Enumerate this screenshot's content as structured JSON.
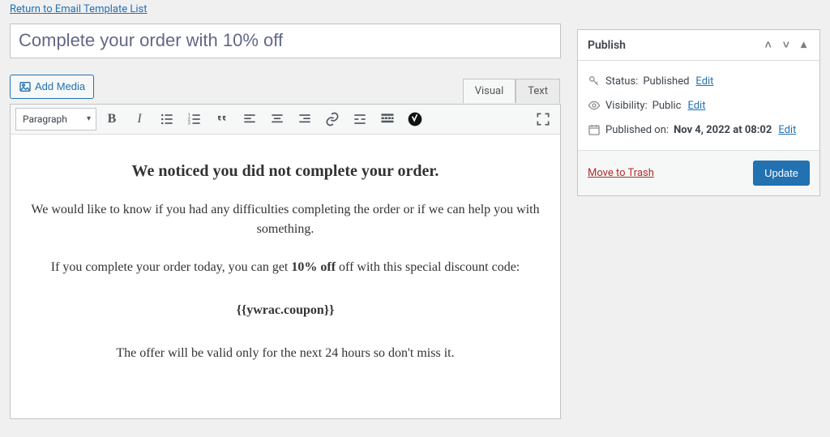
{
  "header": {
    "return_link": "Return to Email Template List",
    "title": "Complete your order with 10% off"
  },
  "editor": {
    "add_media": "Add Media",
    "tabs": {
      "visual": "Visual",
      "text": "Text"
    },
    "format_dropdown": "Paragraph",
    "content": {
      "heading": "We noticed you did not complete your order.",
      "p1": "We would like to know if you had any difficulties completing the order or if we can help you with something.",
      "p2_pre": "If you complete your order today, you can get ",
      "p2_bold": "10% off",
      "p2_post": " off with this special discount code:",
      "coupon": "{{ywrac.coupon}}",
      "p3": "The offer will be valid only for the next 24 hours so don't miss it."
    }
  },
  "publish": {
    "title": "Publish",
    "status_label": "Status: ",
    "status_value": "Published",
    "visibility_label": "Visibility: ",
    "visibility_value": "Public",
    "published_label": "Published on: ",
    "published_value": "Nov 4, 2022 at 08:02",
    "edit": "Edit",
    "trash": "Move to Trash",
    "update": "Update"
  }
}
